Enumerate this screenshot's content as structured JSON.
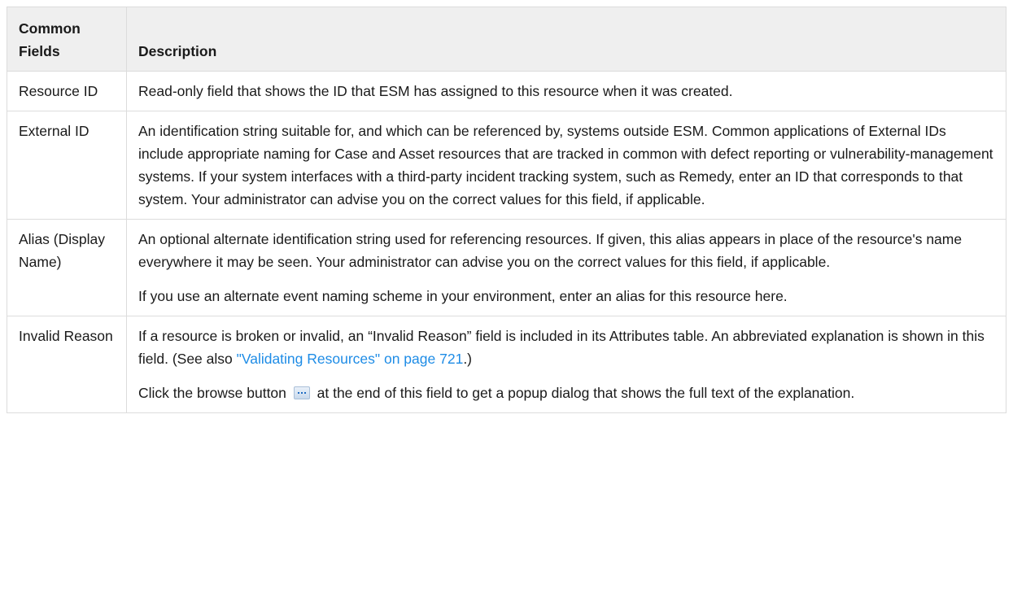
{
  "table": {
    "headers": {
      "field": "Common Fields",
      "description": "Description"
    },
    "rows": [
      {
        "field": "Resource ID",
        "paragraphs": [
          "Read-only field that shows the ID that ESM has assigned to this resource when it was created."
        ]
      },
      {
        "field": "External ID",
        "paragraphs": [
          "An identification string suitable for, and which can be referenced by, systems outside ESM. Common applications of External IDs include appropriate naming for Case and Asset resources that are tracked in common with defect reporting or vulnerability-management systems. If your system interfaces with a third-party incident tracking system, such as Remedy, enter an ID that corresponds to that system. Your administrator can advise you on the correct values for this field, if applicable."
        ]
      },
      {
        "field": "Alias (Display Name)",
        "paragraphs": [
          "An optional alternate identification string used for referencing resources. If given, this alias appears in place of the resource's name everywhere it may be seen. Your administrator can advise you on the correct values for this field, if applicable.",
          "If you use an alternate event naming scheme in your environment, enter an alias for this resource here."
        ]
      },
      {
        "field": "Invalid Reason",
        "p1_text": "If a resource is broken or invalid, an “Invalid Reason” field is included in its Attributes table. An abbreviated explanation is shown in this field. (See also ",
        "p1_link": "\"Validating Resources\" on page 721",
        "p1_end": ".)",
        "p2_before": "Click the browse button ",
        "p2_after": " at the end of this field to get a popup dialog that shows the full text of the explanation."
      }
    ]
  },
  "colors": {
    "header_bg": "#efefef",
    "border": "#dcdcdc",
    "link": "#1e8ce6"
  },
  "icons": {
    "browse": "ellipsis-browse-icon"
  }
}
